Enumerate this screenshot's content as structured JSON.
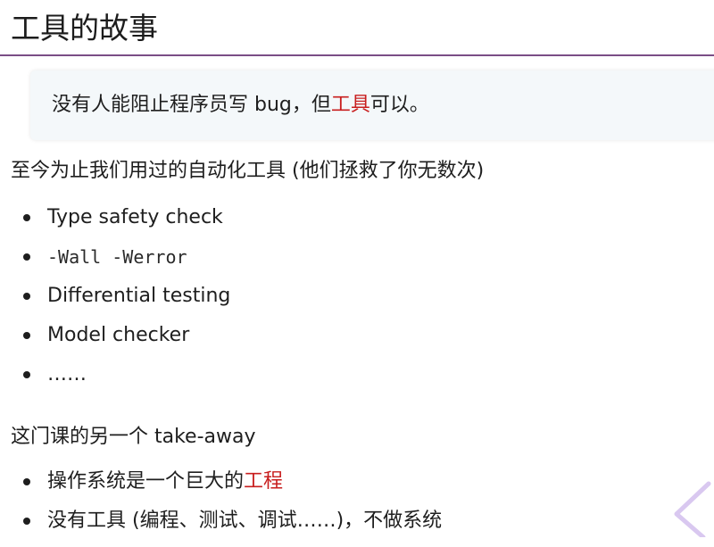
{
  "slide": {
    "title": "工具的故事",
    "callout": {
      "before": "没有人能阻止程序员写 bug，但",
      "highlight": "工具",
      "after": "可以。"
    },
    "intro_paragraph": "至今为止我们用过的自动化工具 (他们拯救了你无数次)",
    "tools": [
      {
        "label": "Type safety check",
        "monospace": false
      },
      {
        "label": "-Wall -Werror",
        "monospace": true
      },
      {
        "label": "Differential testing",
        "monospace": false
      },
      {
        "label": "Model checker",
        "monospace": false
      },
      {
        "label": "……",
        "monospace": false
      }
    ],
    "takeaway_paragraph": "这门课的另一个 take-away",
    "takeaways": [
      {
        "before": "操作系统是一个巨大的",
        "highlight": "工程"
      },
      {
        "before": "没有工具 (编程、测试、调试……)，不做系统",
        "highlight": ""
      }
    ]
  },
  "colors": {
    "accent_red": "#c81e1e",
    "title_rule": "#7a4e86",
    "callout_bg": "#f4f8fa",
    "nav_chevron": "#d9c8f0"
  },
  "icons": {
    "nav": "chevron-left-icon"
  }
}
